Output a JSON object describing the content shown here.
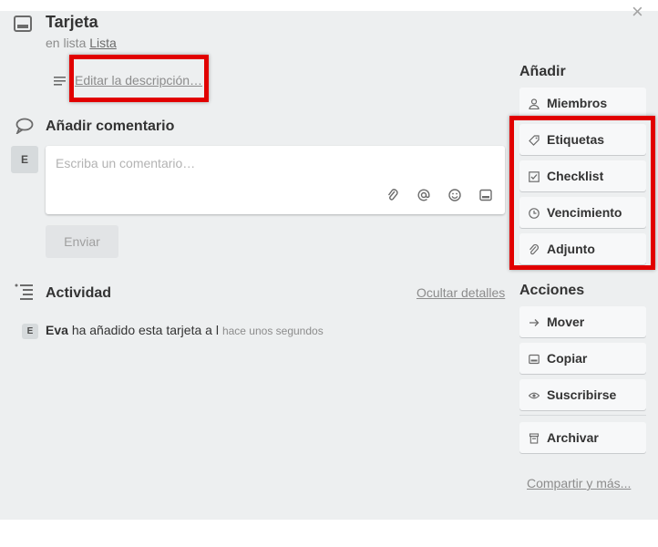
{
  "card": {
    "title": "Tarjeta",
    "in_list_prefix": "en lista",
    "list_name": "Lista",
    "close_glyph": "×"
  },
  "description": {
    "link": "Editar la descripción…"
  },
  "comment": {
    "title": "Añadir comentario",
    "avatar_letter": "E",
    "placeholder": "Escriba un comentario…",
    "icons": [
      "attachment-icon",
      "mention-icon",
      "emoji-icon",
      "card-icon"
    ],
    "send_label": "Enviar"
  },
  "activity": {
    "title": "Actividad",
    "hide_details": "Ocultar detalles",
    "items": [
      {
        "avatar_letter": "E",
        "user": "Eva",
        "text": "ha añadido esta tarjeta a l",
        "time": "hace unos segundos"
      }
    ]
  },
  "sidebar": {
    "add_title": "Añadir",
    "add_buttons": [
      {
        "label": "Miembros",
        "icon": "person-icon"
      },
      {
        "label": "Etiquetas",
        "icon": "tag-icon"
      },
      {
        "label": "Checklist",
        "icon": "checkbox-icon"
      },
      {
        "label": "Vencimiento",
        "icon": "clock-icon"
      },
      {
        "label": "Adjunto",
        "icon": "paperclip-icon"
      }
    ],
    "actions_title": "Acciones",
    "action_buttons": [
      {
        "label": "Mover",
        "icon": "arrow-right-icon"
      },
      {
        "label": "Copiar",
        "icon": "copy-icon"
      },
      {
        "label": "Suscribirse",
        "icon": "eye-icon"
      },
      {
        "label": "Archivar",
        "icon": "archive-icon"
      }
    ],
    "share_link": "Compartir y más..."
  },
  "colors": {
    "highlight": "#e10000",
    "panel_bg": "#edeff0",
    "text": "#333333"
  }
}
